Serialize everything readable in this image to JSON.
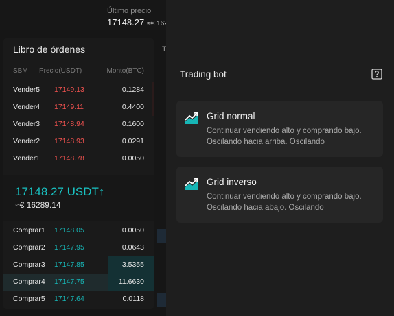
{
  "header": {
    "last_price_label": "Último precio",
    "last_price_value": "17148.27",
    "last_price_conv": "≈€ 162"
  },
  "background": {
    "tab_fragment": "T"
  },
  "orderbook": {
    "title": "Libro de órdenes",
    "columns": {
      "side": "SBM",
      "price": "Precio(USDT)",
      "amount": "Monto(BTC)"
    },
    "asks": [
      {
        "label": "Vender5",
        "price": "17149.13",
        "amount": "0.1284"
      },
      {
        "label": "Vender4",
        "price": "17149.11",
        "amount": "0.4400"
      },
      {
        "label": "Vender3",
        "price": "17148.94",
        "amount": "0.1600"
      },
      {
        "label": "Vender2",
        "price": "17148.93",
        "amount": "0.0291"
      },
      {
        "label": "Vender1",
        "price": "17148.78",
        "amount": "0.0050"
      }
    ],
    "mid_price": "17148.27 USDT↑",
    "mid_conv": "≈€ 16289.14",
    "bids": [
      {
        "label": "Comprar1",
        "price": "17148.05",
        "amount": "0.0050"
      },
      {
        "label": "Comprar2",
        "price": "17147.95",
        "amount": "0.0643"
      },
      {
        "label": "Comprar3",
        "price": "17147.85",
        "amount": "3.5355"
      },
      {
        "label": "Comprar4",
        "price": "17147.75",
        "amount": "11.6630"
      },
      {
        "label": "Comprar5",
        "price": "17147.64",
        "amount": "0.0118"
      }
    ]
  },
  "trading_bot": {
    "title": "Trading bot",
    "help_icon": "help-icon",
    "cards": [
      {
        "icon": "trend-chart-icon",
        "title": "Grid normal",
        "description": "Continuar vendiendo alto y comprando bajo. Oscilando hacia arriba. Oscilando"
      },
      {
        "icon": "trend-chart-icon",
        "title": "Grid inverso",
        "description": "Continuar vendiendo alto y comprando bajo. Oscilando hacia abajo. Oscilando"
      }
    ]
  },
  "colors": {
    "sell": "#f0524f",
    "buy": "#17b6b6",
    "panel_bg": "#1e1e1e",
    "card_bg": "#262626"
  }
}
